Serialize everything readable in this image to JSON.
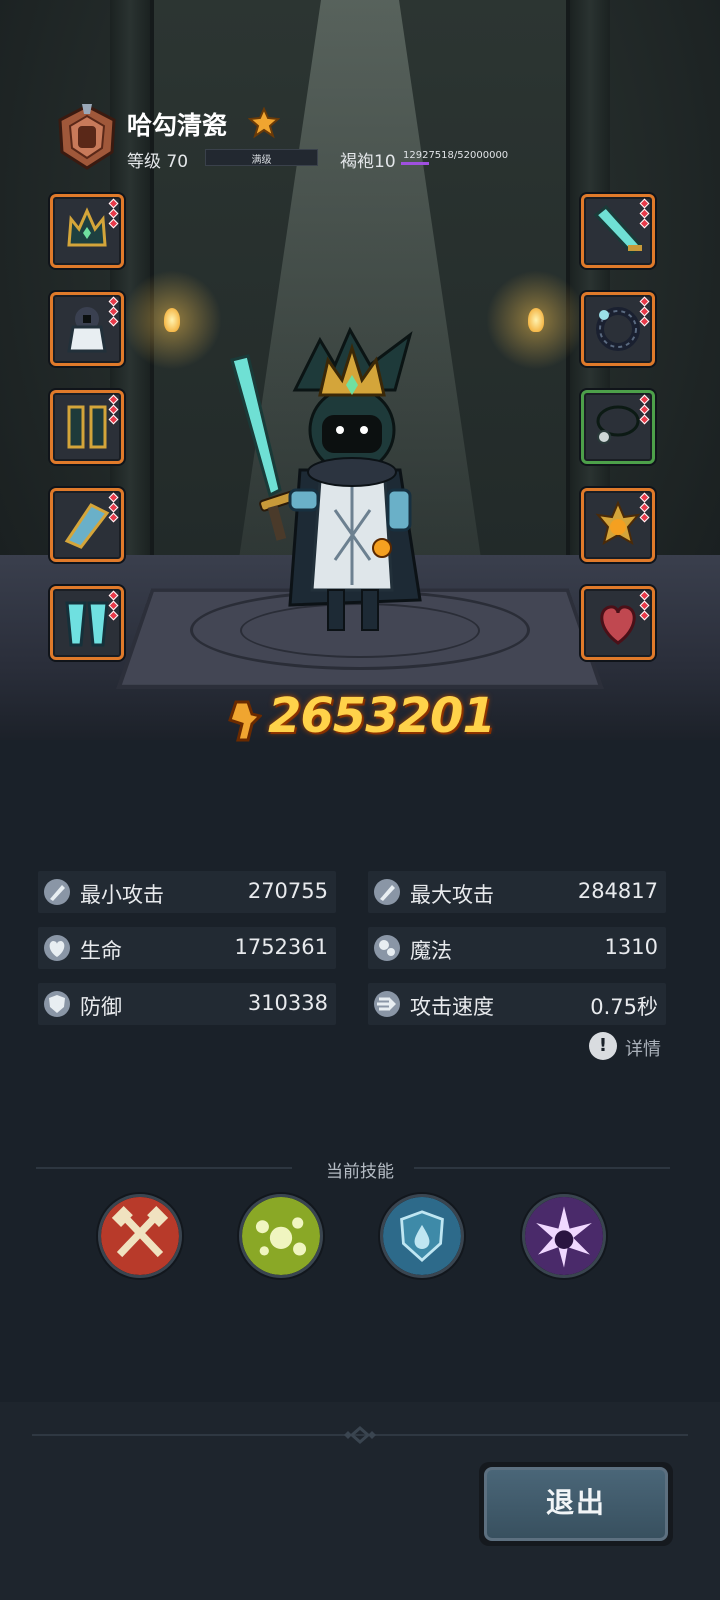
{
  "header": {
    "player_name": "哈勾清瓷",
    "avatar_icon": "armor-crest-icon",
    "badge_icon": "gold-star-badge-icon",
    "level_label": "等级 70",
    "level_bar_text": "满级",
    "level_progress": 1.0,
    "robe_label": "褐袍10",
    "robe_progress_text": "12927518/52000000",
    "robe_progress": 0.2486
  },
  "equipment": {
    "left": [
      {
        "icon": "crown-helmet-icon"
      },
      {
        "icon": "chest-armor-icon"
      },
      {
        "icon": "boots-icon"
      },
      {
        "icon": "bracer-icon"
      },
      {
        "icon": "leg-armor-icon"
      }
    ],
    "right": [
      {
        "icon": "crystal-sword-icon"
      },
      {
        "icon": "dark-ring-icon"
      },
      {
        "icon": "necklace-icon"
      },
      {
        "icon": "flame-amulet-icon"
      },
      {
        "icon": "heart-relic-icon"
      }
    ]
  },
  "power": {
    "value": "2653201",
    "icon": "power-fist-icon"
  },
  "stats": [
    {
      "label": "最小攻击",
      "value": "270755",
      "icon": "sword-icon"
    },
    {
      "label": "最大攻击",
      "value": "284817",
      "icon": "sword-icon"
    },
    {
      "label": "生命",
      "value": "1752361",
      "icon": "heart-icon"
    },
    {
      "label": "魔法",
      "value": "1310",
      "icon": "magic-icon"
    },
    {
      "label": "防御",
      "value": "310338",
      "icon": "shield-icon"
    },
    {
      "label": "攻击速度",
      "value": "0.75秒",
      "icon": "speed-icon"
    }
  ],
  "details": {
    "label": "详情",
    "icon": "exclamation-icon"
  },
  "skills": {
    "title": "当前技能",
    "items": [
      {
        "icon": "crossed-axes-icon",
        "color": "#b83a2a"
      },
      {
        "icon": "bubbles-icon",
        "color": "#8aa826"
      },
      {
        "icon": "water-shield-icon",
        "color": "#2d6a8a"
      },
      {
        "icon": "dark-burst-icon",
        "color": "#4a2a6a"
      }
    ]
  },
  "exit_button": {
    "label": "退出"
  },
  "colors": {
    "background": "#1a2129",
    "power_gold": "#ffd24a",
    "slot_border_orange": "#e07a2a",
    "slot_border_green": "#4da04a",
    "robe_bar": "#a050e0"
  }
}
